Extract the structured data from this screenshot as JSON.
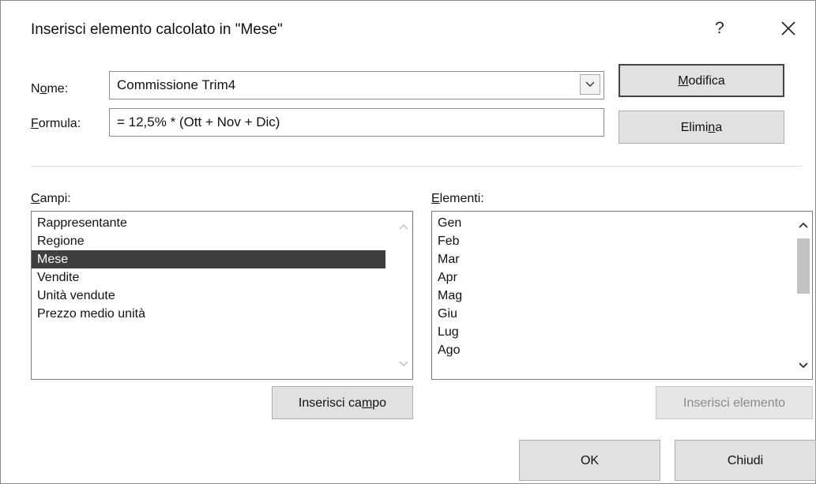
{
  "dialog": {
    "title": "Inserisci elemento calcolato in \"Mese\"",
    "help_label": "?"
  },
  "name_row": {
    "label_prefix": "N",
    "label_accel": "o",
    "label_suffix": "me:",
    "value": "Commissione Trim4"
  },
  "formula_row": {
    "label_accel": "F",
    "label_suffix": "ormula:",
    "value": "= 12,5% * (Ott + Nov + Dic)"
  },
  "buttons": {
    "modifica": {
      "accel": "M",
      "rest": "odifica"
    },
    "elimina": {
      "prefix": "Elimi",
      "accel": "n",
      "suffix": "a"
    },
    "inserisci_campo": {
      "prefix": "Inserisci ca",
      "accel": "m",
      "suffix": "po"
    },
    "inserisci_elemento": "Inserisci elemento",
    "ok": "OK",
    "chiudi": "Chiudi"
  },
  "fields_panel": {
    "label_accel": "C",
    "label_suffix": "ampi:",
    "items": [
      "Rappresentante",
      "Regione",
      "Mese",
      "Vendite",
      "Unità vendute",
      "Prezzo medio unità"
    ],
    "selected": "Mese"
  },
  "items_panel": {
    "label_accel": "E",
    "label_suffix": "lementi:",
    "items": [
      "Gen",
      "Feb",
      "Mar",
      "Apr",
      "Mag",
      "Giu",
      "Lug",
      "Ago"
    ]
  },
  "colors": {
    "selection_bg": "#3f3f3f",
    "button_bg": "#e1e1e1",
    "scroll_thumb": "#c2c2c2"
  },
  "icons": [
    "close-icon",
    "chevron-down-icon",
    "scroll-up-arrow-icon",
    "scroll-down-arrow-icon"
  ]
}
